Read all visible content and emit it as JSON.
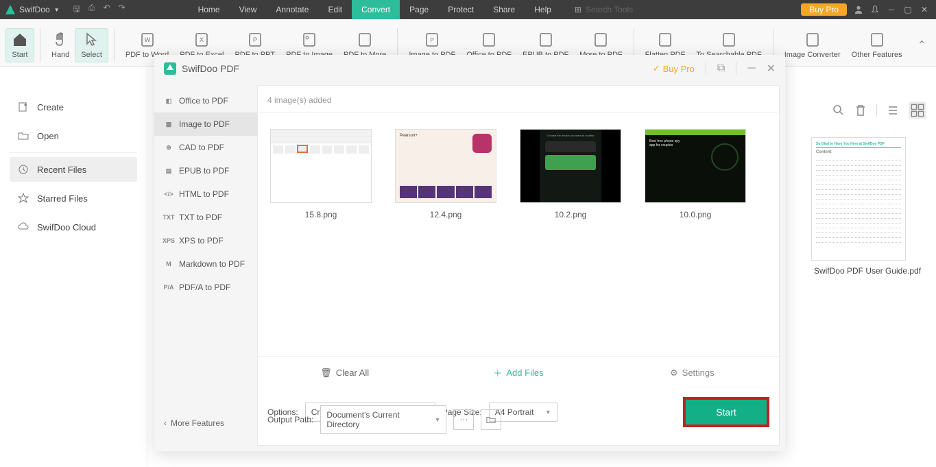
{
  "app": {
    "name": "SwifDoo",
    "buy_pro": "Buy Pro",
    "search_placeholder": "Search Tools"
  },
  "menu": {
    "home": "Home",
    "view": "View",
    "annotate": "Annotate",
    "edit": "Edit",
    "convert": "Convert",
    "page": "Page",
    "protect": "Protect",
    "share": "Share",
    "help": "Help"
  },
  "ribbon": {
    "start": "Start",
    "hand": "Hand",
    "select": "Select",
    "pdf_to_word": "PDF to Word",
    "pdf_to_excel": "PDF to Excel",
    "pdf_to_ppt": "PDF to PPT",
    "pdf_to_image": "PDF to Image",
    "pdf_to_more": "PDF to More",
    "image_to_pdf": "Image to PDF",
    "office_to_pdf": "Office to PDF",
    "epub_to_pdf": "EPUB to PDF",
    "more_to_pdf": "More to PDF",
    "flatten": "Flatten PDF",
    "searchable": "To Searchable PDF",
    "img_conv": "Image Converter",
    "other": "Other Features"
  },
  "sidebar": {
    "create": "Create",
    "open": "Open",
    "recent": "Recent Files",
    "starred": "Starred Files",
    "cloud": "SwifDoo Cloud"
  },
  "rightdoc": {
    "label": "SwifDoo PDF User Guide.pdf",
    "heading": "So Glad to Have You Here at SwifDoo PDF",
    "content": "Content"
  },
  "dialog": {
    "title": "SwifDoo PDF",
    "buy_pro": "Buy Pro",
    "side": {
      "office": "Office to PDF",
      "image": "Image to PDF",
      "cad": "CAD to PDF",
      "epub": "EPUB to PDF",
      "html": "HTML to PDF",
      "txt": "TXT to PDF",
      "xps": "XPS to PDF",
      "md": "Markdown to PDF",
      "pdfa": "PDF/A to PDF",
      "more": "More Features"
    },
    "count": "4 image(s) added",
    "thumbs": [
      "15.8.png",
      "12.4.png",
      "10.2.png",
      "10.0.png"
    ],
    "clear": "Clear All",
    "add": "Add Files",
    "settings": "Settings",
    "options_label": "Options:",
    "options_value": "Create a New PDF",
    "pagesize_label": "Page Size:",
    "pagesize_value": "A4 Portrait",
    "output_label": "Output Path:",
    "output_value": "Document's Current Directory",
    "start": "Start",
    "mini3_text": "Choose the device you want to monitor",
    "mini4_text": "Best free phone spy app for couples"
  }
}
